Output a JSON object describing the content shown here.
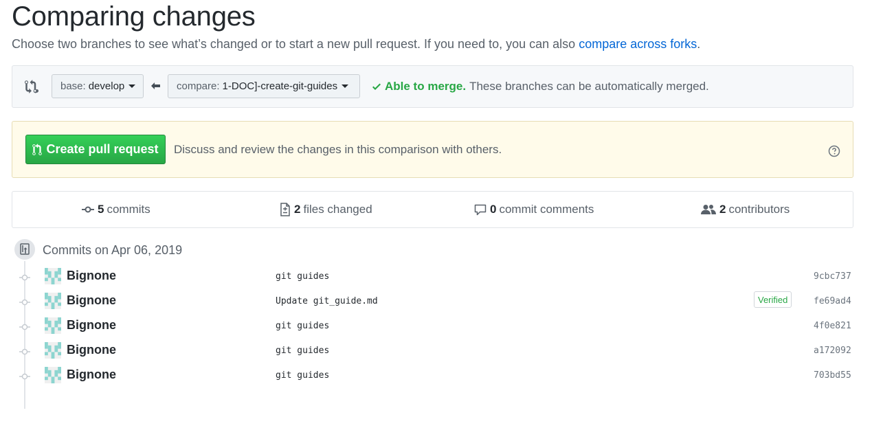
{
  "header": {
    "title": "Comparing changes",
    "subtitle_text": "Choose two branches to see what’s changed or to start a new pull request. If you need to, you can also",
    "subtitle_link": "compare across forks",
    "subtitle_end": "."
  },
  "range": {
    "base_label": "base:",
    "base_value": "develop",
    "compare_label": "compare:",
    "compare_value": "1-DOC]-create-git-guides",
    "merge_ok": "Able to merge.",
    "merge_rest": "These branches can be automatically merged."
  },
  "pull_request": {
    "button_label": "Create pull request",
    "description": "Discuss and review the changes in this comparison with others."
  },
  "summary": {
    "commits_count": "5",
    "commits_label": "commits",
    "files_count": "2",
    "files_label": "files changed",
    "comments_count": "0",
    "comments_label": "commit comments",
    "contributors_count": "2",
    "contributors_label": "contributors"
  },
  "commit_group": {
    "title": "Commits on Apr 06, 2019"
  },
  "commits": [
    {
      "author": "Bignone",
      "message": "git guides",
      "sha": "9cbc737",
      "verified": ""
    },
    {
      "author": "Bignone",
      "message": "Update git_guide.md",
      "sha": "fe69ad4",
      "verified": "Verified"
    },
    {
      "author": "Bignone",
      "message": "git guides",
      "sha": "4f0e821",
      "verified": ""
    },
    {
      "author": "Bignone",
      "message": "git guides",
      "sha": "a172092",
      "verified": ""
    },
    {
      "author": "Bignone",
      "message": "git guides",
      "sha": "703bd55",
      "verified": ""
    }
  ],
  "colors": {
    "accent_green": "#28a745",
    "link_blue": "#0366d6",
    "notice_bg": "#fffbea"
  },
  "icons": [
    "compare-icon",
    "arrow-left-icon",
    "check-icon",
    "pull-request-icon",
    "question-icon",
    "commit-icon",
    "file-diff-icon",
    "comment-icon",
    "people-icon",
    "repo-push-icon",
    "git-commit-node-icon",
    "identicon-avatar"
  ]
}
